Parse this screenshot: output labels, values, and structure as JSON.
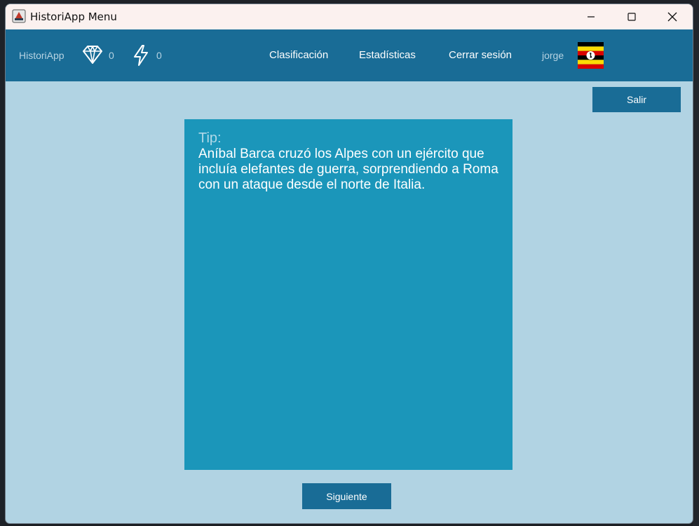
{
  "window": {
    "title": "HistoriApp Menu",
    "controls": {
      "minimize": "minimize-icon",
      "maximize": "maximize-icon",
      "close": "close-icon"
    }
  },
  "navbar": {
    "brand": "HistoriApp",
    "gems": "0",
    "energy": "0",
    "links": {
      "ranking": "Clasificación",
      "stats": "Estadísticas",
      "logout": "Cerrar sesión"
    },
    "username": "jorge",
    "flag_icon": "uganda-flag-icon"
  },
  "actions": {
    "exit_label": "Salir",
    "next_label": "Siguiente"
  },
  "tip": {
    "label": "Tip:",
    "text": "Aníbal Barca cruzó los Alpes con un ejército que incluía elefantes de guerra, sorprendiendo a Roma con un ataque desde el norte de Italia."
  },
  "colors": {
    "navbar": "#196c96",
    "background": "#b1d3e3",
    "card": "#1b96ba",
    "titlebar": "#fbf1ef"
  }
}
